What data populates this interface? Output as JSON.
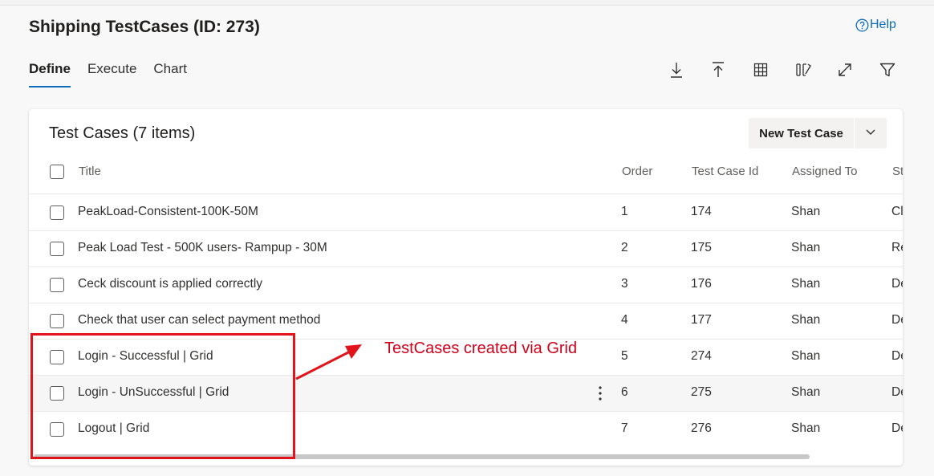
{
  "page": {
    "title": "Shipping TestCases (ID: 273)",
    "help_label": "Help"
  },
  "tabs": [
    {
      "label": "Define",
      "active": true
    },
    {
      "label": "Execute",
      "active": false
    },
    {
      "label": "Chart",
      "active": false
    }
  ],
  "toolbar": {
    "icons": [
      "download-icon",
      "upload-icon",
      "grid-view-icon",
      "column-options-icon",
      "fullscreen-icon",
      "filter-icon"
    ]
  },
  "card": {
    "title": "Test Cases (7 items)",
    "new_button_label": "New Test Case"
  },
  "table": {
    "columns": {
      "title": "Title",
      "order": "Order",
      "id": "Test Case Id",
      "assigned": "Assigned To",
      "state": "St"
    },
    "rows": [
      {
        "title": "PeakLoad-Consistent-100K-50M",
        "order": "1",
        "id": "174",
        "assigned": "Shan",
        "state": "Cl"
      },
      {
        "title": "Peak Load Test - 500K users- Rampup - 30M",
        "order": "2",
        "id": "175",
        "assigned": "Shan",
        "state": "Re"
      },
      {
        "title": "Ceck discount is applied correctly",
        "order": "3",
        "id": "176",
        "assigned": "Shan",
        "state": "De"
      },
      {
        "title": "Check that user can select payment method",
        "order": "4",
        "id": "177",
        "assigned": "Shan",
        "state": "De"
      },
      {
        "title": "Login - Successful | Grid",
        "order": "5",
        "id": "274",
        "assigned": "Shan",
        "state": "De"
      },
      {
        "title": "Login - UnSuccessful | Grid",
        "order": "6",
        "id": "275",
        "assigned": "Shan",
        "state": "De"
      },
      {
        "title": "Logout | Grid",
        "order": "7",
        "id": "276",
        "assigned": "Shan",
        "state": "De"
      }
    ]
  },
  "annotation": {
    "text": "TestCases created via Grid",
    "color": "#e2141b"
  },
  "colors": {
    "accent": "#0f6cbd",
    "annotation": "#e2141b"
  }
}
